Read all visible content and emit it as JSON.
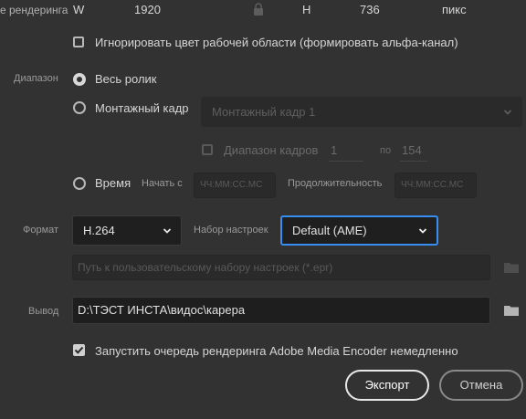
{
  "render": {
    "label": "е рендеринга",
    "w_label": "W",
    "w_value": "1920",
    "h_label": "H",
    "h_value": "736",
    "unit": "пикс"
  },
  "ignore_workspace_color": {
    "label": "Игнорировать цвет рабочей области (формировать альфа-канал)",
    "checked": false
  },
  "range": {
    "label": "Диапазон",
    "whole_clip": "Весь ролик",
    "work_frame": "Монтажный кадр",
    "work_frame_select": "Монтажный кадр 1",
    "frame_range_label": "Диапазон кадров",
    "frame_from": "1",
    "frame_to_label": "по",
    "frame_to": "154",
    "time_label": "Время",
    "start_label": "Начать с",
    "start_placeholder": "ЧЧ:ММ:СС.МС",
    "duration_label": "Продолжительность",
    "duration_placeholder": "ЧЧ:ММ:СС.МС"
  },
  "format": {
    "label": "Формат",
    "value": "H.264",
    "preset_label": "Набор настроек",
    "preset_value": "Default (AME)",
    "custom_preset_placeholder": "Путь к пользовательскому набору настроек (*.epr)"
  },
  "output": {
    "label": "Вывод",
    "path": "D:\\ТЭСТ ИНСТА\\видос\\карера"
  },
  "queue": {
    "label": "Запустить очередь рендеринга Adobe Media Encoder немедленно",
    "checked": true
  },
  "buttons": {
    "export": "Экспорт",
    "cancel": "Отмена"
  },
  "icons": {
    "lock": "lock-icon",
    "folder": "folder-icon",
    "chevron": "chevron-down-icon",
    "check": "checkmark-icon"
  },
  "colors": {
    "background": "#323232",
    "focus_accent": "#378ef0"
  }
}
